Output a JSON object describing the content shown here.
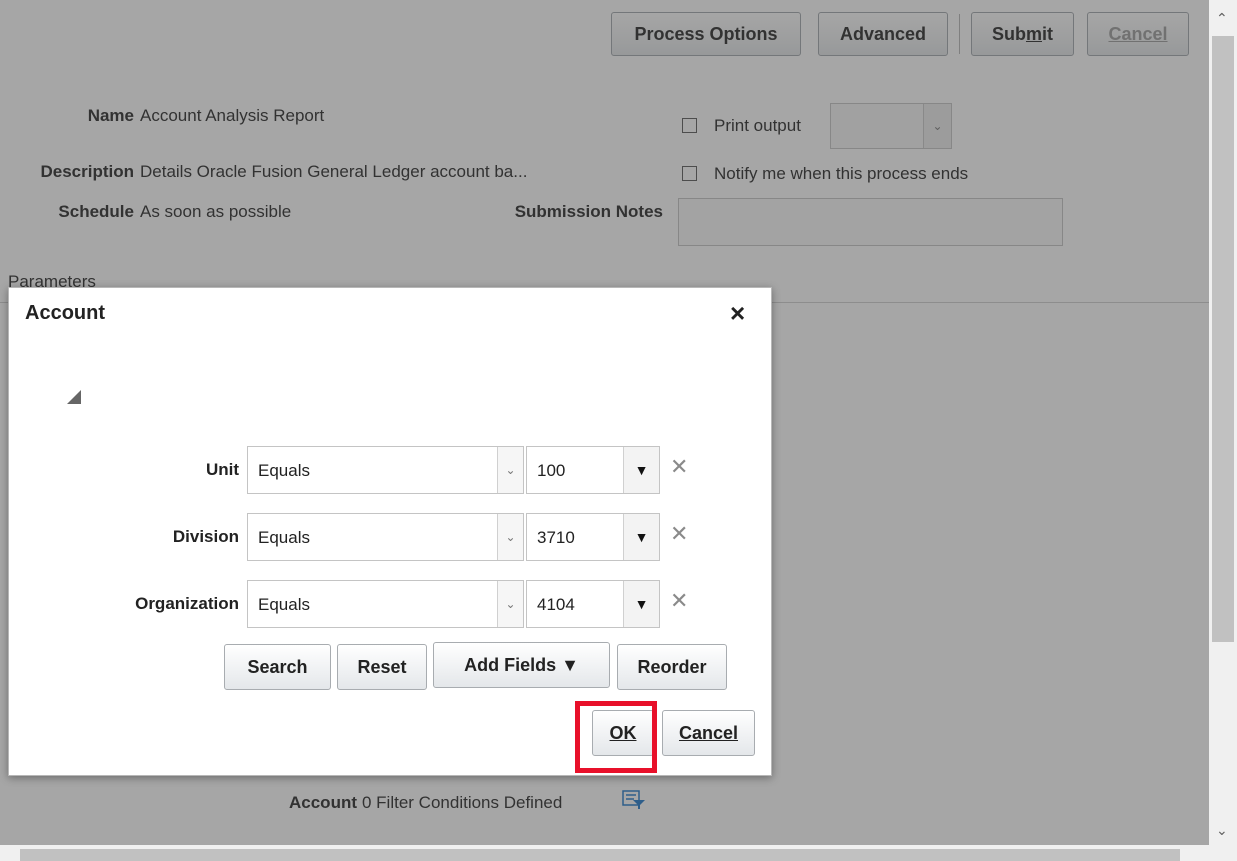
{
  "toolbar": {
    "process_options": "Process Options",
    "advanced": "Advanced",
    "submit": "Submit",
    "cancel": "Cancel"
  },
  "form": {
    "name_label": "Name",
    "name_value": "Account Analysis Report",
    "description_label": "Description",
    "description_value": "Details Oracle Fusion General Ledger account ba...",
    "schedule_label": "Schedule",
    "schedule_value": "As soon as possible",
    "submission_notes_label": "Submission Notes",
    "print_output_label": "Print output",
    "notify_label": "Notify me when this process ends",
    "parameters_label": "Parameters",
    "account_label": "Account",
    "account_value": "0 Filter Conditions Defined"
  },
  "dialog": {
    "title": "Account",
    "close_glyph": "×",
    "rows": [
      {
        "label": "Unit",
        "operator": "Equals",
        "value": "100"
      },
      {
        "label": "Division",
        "operator": "Equals",
        "value": "3710"
      },
      {
        "label": "Organization",
        "operator": "Equals",
        "value": "4104"
      }
    ],
    "search": "Search",
    "reset": "Reset",
    "add_fields": "Add Fields ▼",
    "reorder": "Reorder",
    "ok": "OK",
    "cancel": "Cancel"
  },
  "colors": {
    "highlight": "#e8102a",
    "filter_icon": "#1a76c9"
  },
  "icons": {
    "close": "close-icon",
    "remove": "remove-condition-icon",
    "filter": "filter-icon",
    "disclosure": "disclosure-triangle-icon"
  }
}
